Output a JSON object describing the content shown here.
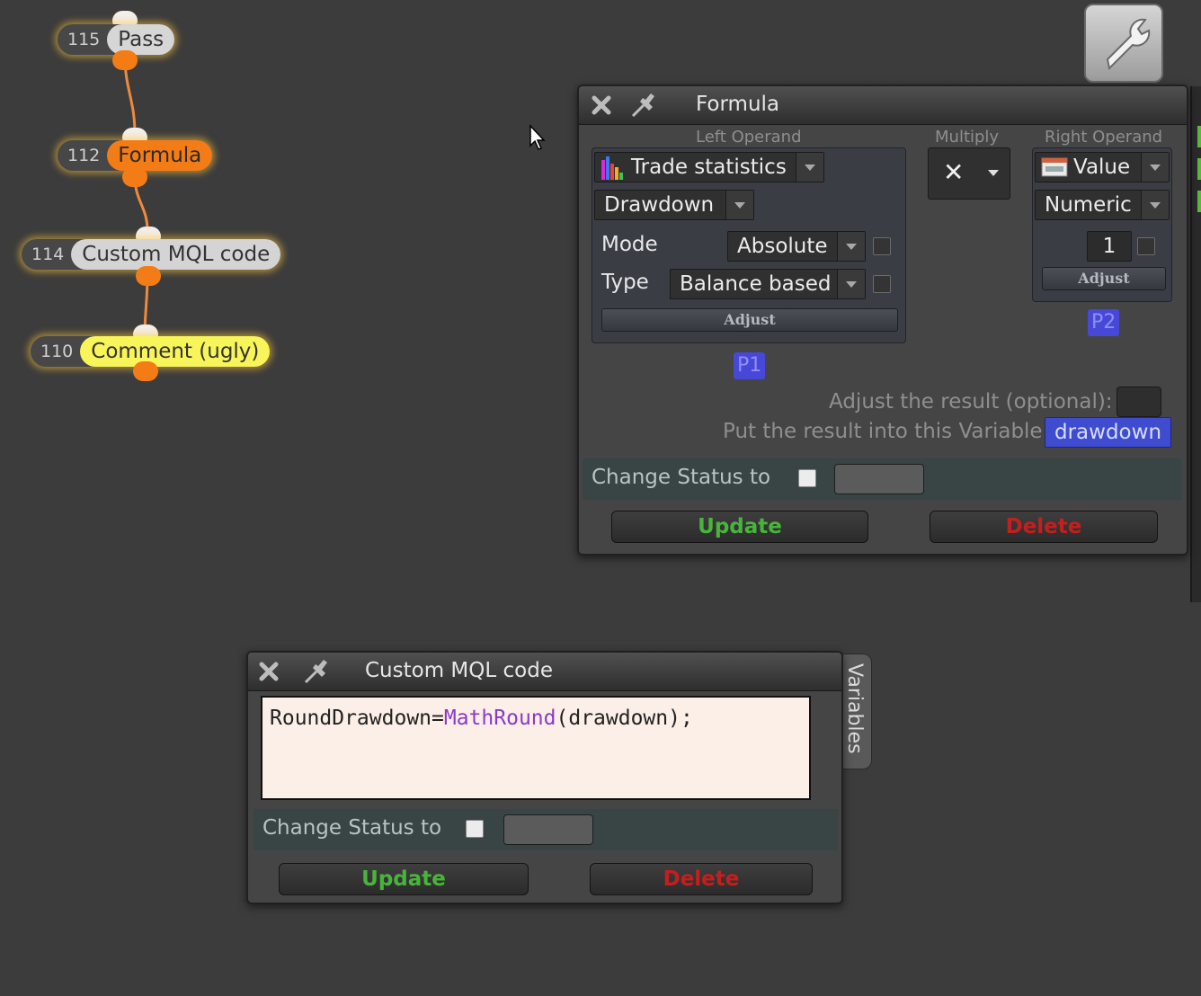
{
  "nodes": [
    {
      "id": "115",
      "label": "Pass"
    },
    {
      "id": "112",
      "label": "Formula"
    },
    {
      "id": "114",
      "label": "Custom MQL code"
    },
    {
      "id": "110",
      "label": "Comment (ugly)"
    }
  ],
  "formula_window": {
    "title": "Formula",
    "left_operand_label": "Left Operand",
    "operator_label": "Multiply",
    "operator_symbol": "✕",
    "right_operand_label": "Right Operand",
    "left": {
      "source": "Trade statistics",
      "metric": "Drawdown",
      "mode_label": "Mode",
      "mode_value": "Absolute",
      "type_label": "Type",
      "type_value": "Balance based",
      "adjust_label": "Adjust",
      "badge": "P1"
    },
    "right": {
      "source": "Value",
      "kind": "Numeric",
      "value": "1",
      "adjust_label": "Adjust",
      "badge": "P2"
    },
    "adjust_result_label": "Adjust the result (optional):",
    "result_variable_label": "Put the result into this Variable:",
    "result_variable": "drawdown",
    "change_status_label": "Change Status to",
    "update_label": "Update",
    "delete_label": "Delete"
  },
  "mql_window": {
    "title": "Custom MQL code",
    "code_prefix": "RoundDrawdown=",
    "code_function": "MathRound",
    "code_suffix": "(drawdown);",
    "change_status_label": "Change Status to",
    "update_label": "Update",
    "delete_label": "Delete",
    "side_tab": "Variables"
  },
  "colors": {
    "background": "#3c3c3c",
    "node_orange": "#f47c16",
    "node_yellow": "#f8f55a",
    "node_gray": "#d4d4d4",
    "update_green": "#49b43b",
    "delete_red": "#c31f1f",
    "variable_blue": "#3f4cd0"
  }
}
